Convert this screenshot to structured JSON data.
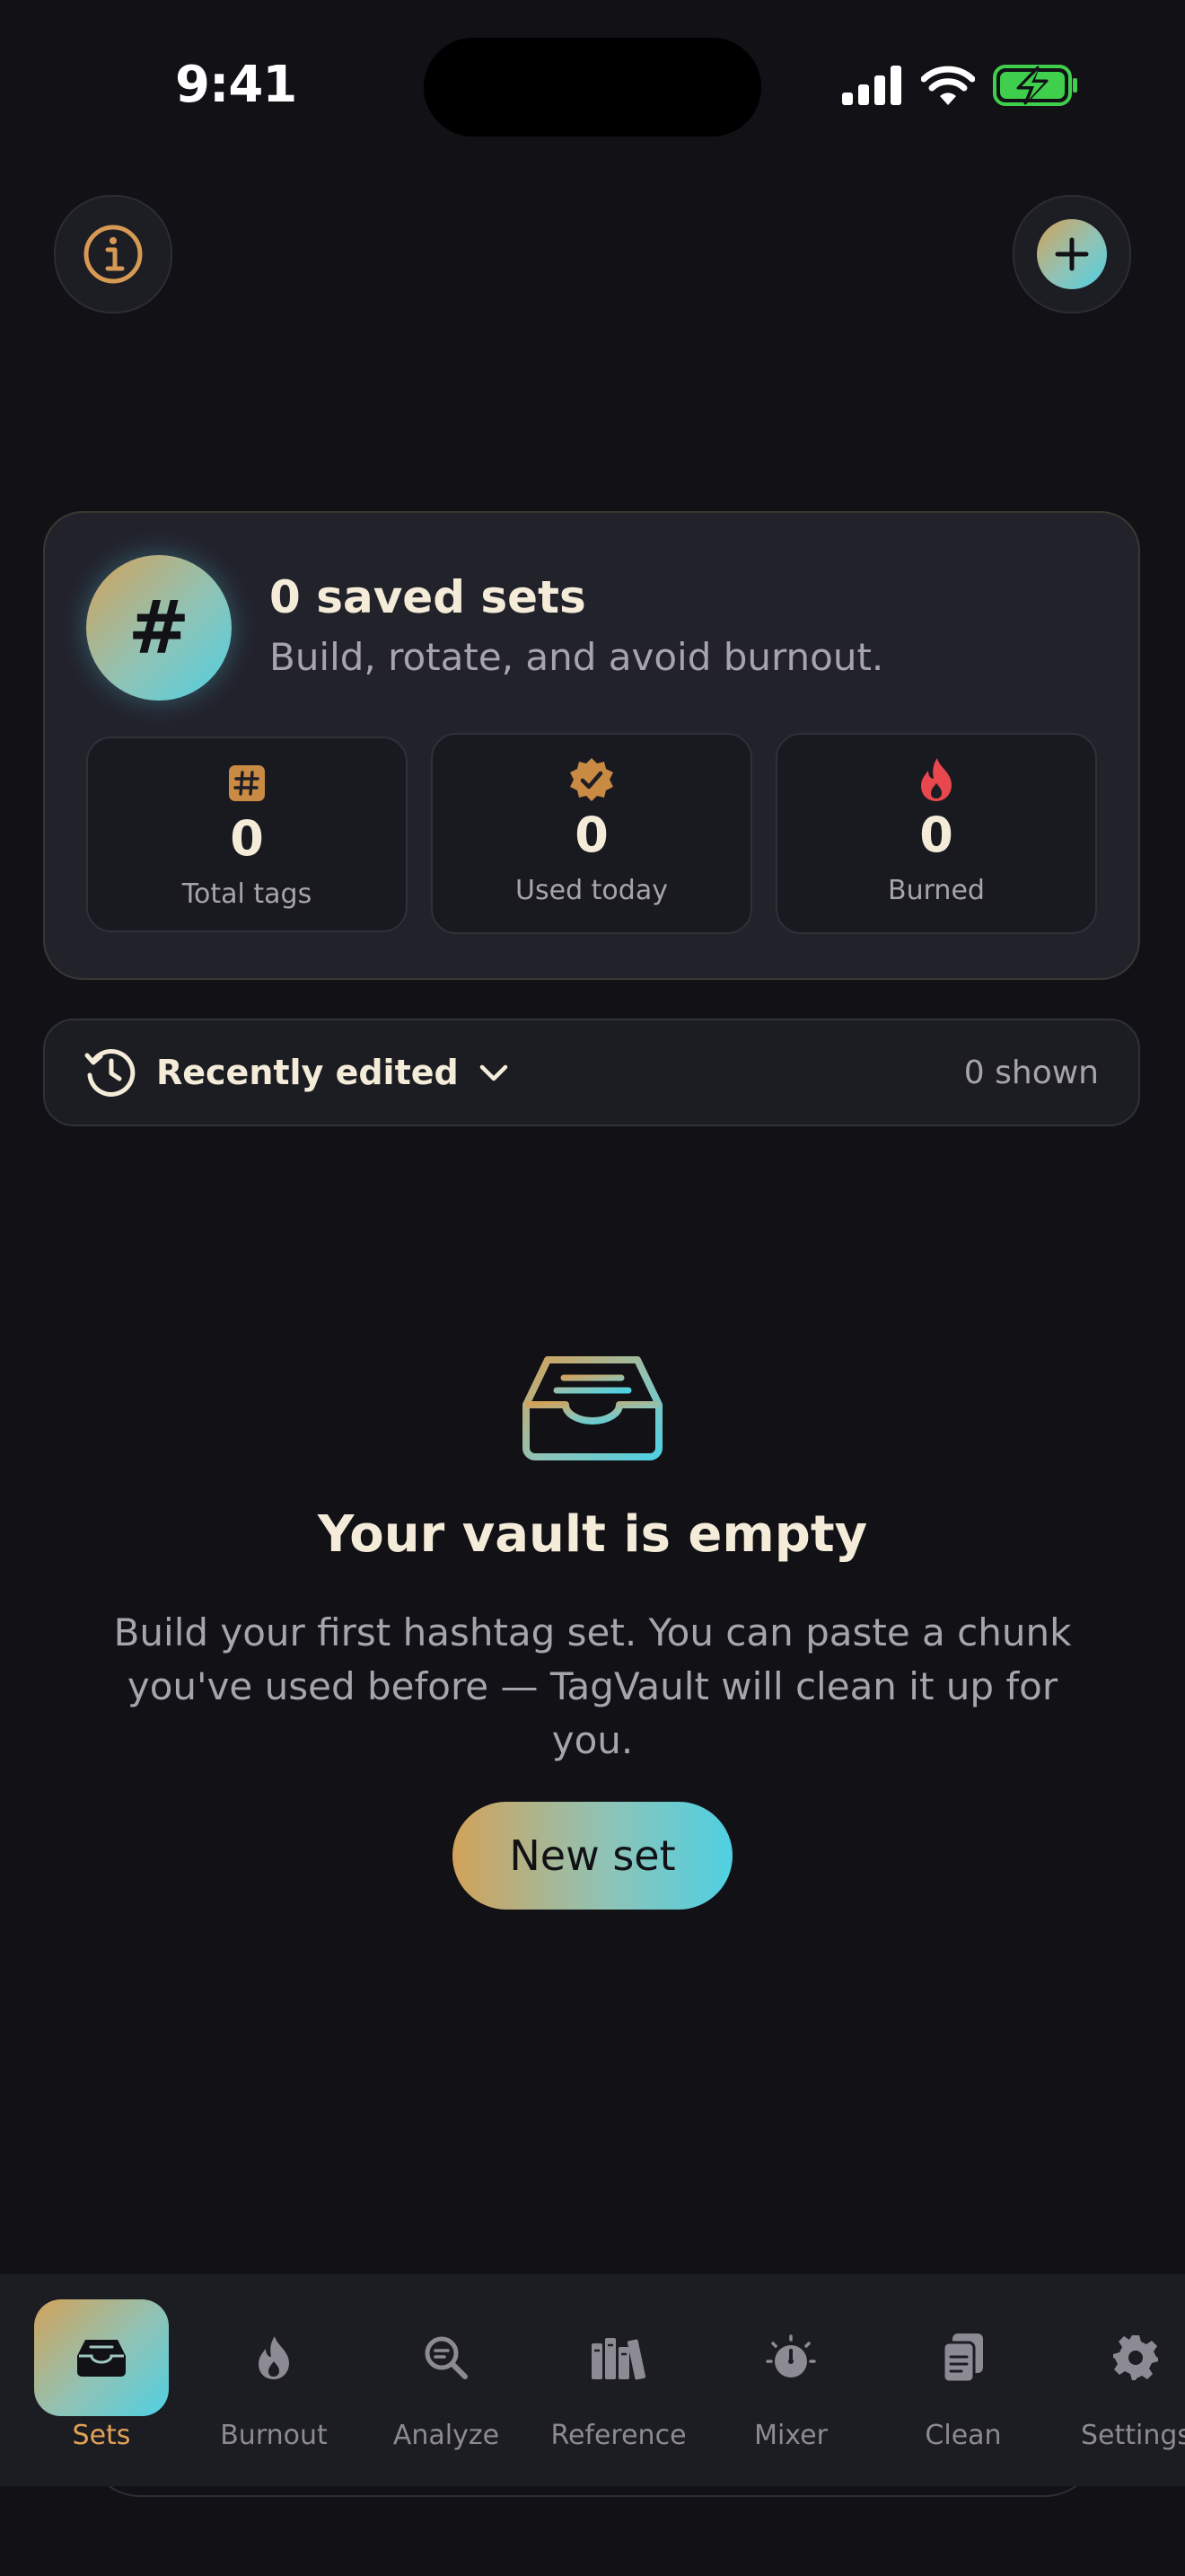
{
  "status_bar": {
    "time": "9:41"
  },
  "summary": {
    "icon_symbol": "#",
    "title": "0 saved sets",
    "subtitle": "Build, rotate, and avoid burnout.",
    "stats": [
      {
        "icon": "hash-badge-icon",
        "value": "0",
        "label": "Total tags"
      },
      {
        "icon": "verified-badge-icon",
        "value": "0",
        "label": "Used today"
      },
      {
        "icon": "flame-icon",
        "value": "0",
        "label": "Burned"
      }
    ]
  },
  "sort": {
    "label": "Recently edited",
    "count": "0 shown"
  },
  "empty_state": {
    "title": "Your vault is empty",
    "body": "Build your first hashtag set. You can paste a chunk you've used before — TagVault will clean it up for you.",
    "button": "New set"
  },
  "tabs": [
    {
      "label": "Sets",
      "icon": "tray-icon",
      "active": true
    },
    {
      "label": "Burnout",
      "icon": "flame-icon"
    },
    {
      "label": "Analyze",
      "icon": "magnifier-icon"
    },
    {
      "label": "Reference",
      "icon": "books-icon"
    },
    {
      "label": "Mixer",
      "icon": "timer-icon"
    },
    {
      "label": "Clean",
      "icon": "clipboard-icon"
    },
    {
      "label": "Settings",
      "icon": "gear-icon"
    }
  ],
  "colors": {
    "background": "#111116",
    "card": "#22222b",
    "accent_gold": "#d2a25a",
    "accent_cyan": "#4fd0e2",
    "burn_red": "#e8474e",
    "battery_green": "#3fcf4c"
  }
}
